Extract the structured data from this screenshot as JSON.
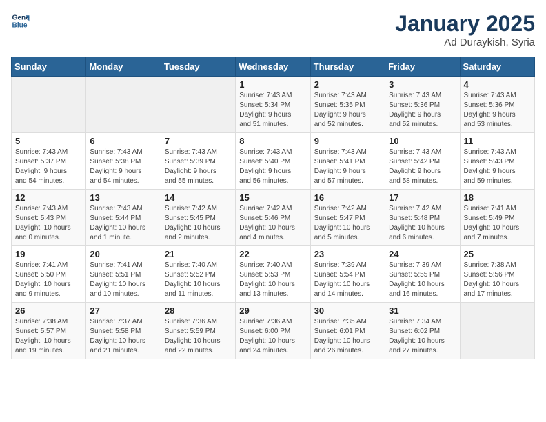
{
  "logo": {
    "line1": "General",
    "line2": "Blue"
  },
  "title": "January 2025",
  "subtitle": "Ad Duraykish, Syria",
  "days_header": [
    "Sunday",
    "Monday",
    "Tuesday",
    "Wednesday",
    "Thursday",
    "Friday",
    "Saturday"
  ],
  "weeks": [
    [
      {
        "day": "",
        "detail": ""
      },
      {
        "day": "",
        "detail": ""
      },
      {
        "day": "",
        "detail": ""
      },
      {
        "day": "1",
        "detail": "Sunrise: 7:43 AM\nSunset: 5:34 PM\nDaylight: 9 hours\nand 51 minutes."
      },
      {
        "day": "2",
        "detail": "Sunrise: 7:43 AM\nSunset: 5:35 PM\nDaylight: 9 hours\nand 52 minutes."
      },
      {
        "day": "3",
        "detail": "Sunrise: 7:43 AM\nSunset: 5:36 PM\nDaylight: 9 hours\nand 52 minutes."
      },
      {
        "day": "4",
        "detail": "Sunrise: 7:43 AM\nSunset: 5:36 PM\nDaylight: 9 hours\nand 53 minutes."
      }
    ],
    [
      {
        "day": "5",
        "detail": "Sunrise: 7:43 AM\nSunset: 5:37 PM\nDaylight: 9 hours\nand 54 minutes."
      },
      {
        "day": "6",
        "detail": "Sunrise: 7:43 AM\nSunset: 5:38 PM\nDaylight: 9 hours\nand 54 minutes."
      },
      {
        "day": "7",
        "detail": "Sunrise: 7:43 AM\nSunset: 5:39 PM\nDaylight: 9 hours\nand 55 minutes."
      },
      {
        "day": "8",
        "detail": "Sunrise: 7:43 AM\nSunset: 5:40 PM\nDaylight: 9 hours\nand 56 minutes."
      },
      {
        "day": "9",
        "detail": "Sunrise: 7:43 AM\nSunset: 5:41 PM\nDaylight: 9 hours\nand 57 minutes."
      },
      {
        "day": "10",
        "detail": "Sunrise: 7:43 AM\nSunset: 5:42 PM\nDaylight: 9 hours\nand 58 minutes."
      },
      {
        "day": "11",
        "detail": "Sunrise: 7:43 AM\nSunset: 5:43 PM\nDaylight: 9 hours\nand 59 minutes."
      }
    ],
    [
      {
        "day": "12",
        "detail": "Sunrise: 7:43 AM\nSunset: 5:43 PM\nDaylight: 10 hours\nand 0 minutes."
      },
      {
        "day": "13",
        "detail": "Sunrise: 7:43 AM\nSunset: 5:44 PM\nDaylight: 10 hours\nand 1 minute."
      },
      {
        "day": "14",
        "detail": "Sunrise: 7:42 AM\nSunset: 5:45 PM\nDaylight: 10 hours\nand 2 minutes."
      },
      {
        "day": "15",
        "detail": "Sunrise: 7:42 AM\nSunset: 5:46 PM\nDaylight: 10 hours\nand 4 minutes."
      },
      {
        "day": "16",
        "detail": "Sunrise: 7:42 AM\nSunset: 5:47 PM\nDaylight: 10 hours\nand 5 minutes."
      },
      {
        "day": "17",
        "detail": "Sunrise: 7:42 AM\nSunset: 5:48 PM\nDaylight: 10 hours\nand 6 minutes."
      },
      {
        "day": "18",
        "detail": "Sunrise: 7:41 AM\nSunset: 5:49 PM\nDaylight: 10 hours\nand 7 minutes."
      }
    ],
    [
      {
        "day": "19",
        "detail": "Sunrise: 7:41 AM\nSunset: 5:50 PM\nDaylight: 10 hours\nand 9 minutes."
      },
      {
        "day": "20",
        "detail": "Sunrise: 7:41 AM\nSunset: 5:51 PM\nDaylight: 10 hours\nand 10 minutes."
      },
      {
        "day": "21",
        "detail": "Sunrise: 7:40 AM\nSunset: 5:52 PM\nDaylight: 10 hours\nand 11 minutes."
      },
      {
        "day": "22",
        "detail": "Sunrise: 7:40 AM\nSunset: 5:53 PM\nDaylight: 10 hours\nand 13 minutes."
      },
      {
        "day": "23",
        "detail": "Sunrise: 7:39 AM\nSunset: 5:54 PM\nDaylight: 10 hours\nand 14 minutes."
      },
      {
        "day": "24",
        "detail": "Sunrise: 7:39 AM\nSunset: 5:55 PM\nDaylight: 10 hours\nand 16 minutes."
      },
      {
        "day": "25",
        "detail": "Sunrise: 7:38 AM\nSunset: 5:56 PM\nDaylight: 10 hours\nand 17 minutes."
      }
    ],
    [
      {
        "day": "26",
        "detail": "Sunrise: 7:38 AM\nSunset: 5:57 PM\nDaylight: 10 hours\nand 19 minutes."
      },
      {
        "day": "27",
        "detail": "Sunrise: 7:37 AM\nSunset: 5:58 PM\nDaylight: 10 hours\nand 21 minutes."
      },
      {
        "day": "28",
        "detail": "Sunrise: 7:36 AM\nSunset: 5:59 PM\nDaylight: 10 hours\nand 22 minutes."
      },
      {
        "day": "29",
        "detail": "Sunrise: 7:36 AM\nSunset: 6:00 PM\nDaylight: 10 hours\nand 24 minutes."
      },
      {
        "day": "30",
        "detail": "Sunrise: 7:35 AM\nSunset: 6:01 PM\nDaylight: 10 hours\nand 26 minutes."
      },
      {
        "day": "31",
        "detail": "Sunrise: 7:34 AM\nSunset: 6:02 PM\nDaylight: 10 hours\nand 27 minutes."
      },
      {
        "day": "",
        "detail": ""
      }
    ]
  ]
}
